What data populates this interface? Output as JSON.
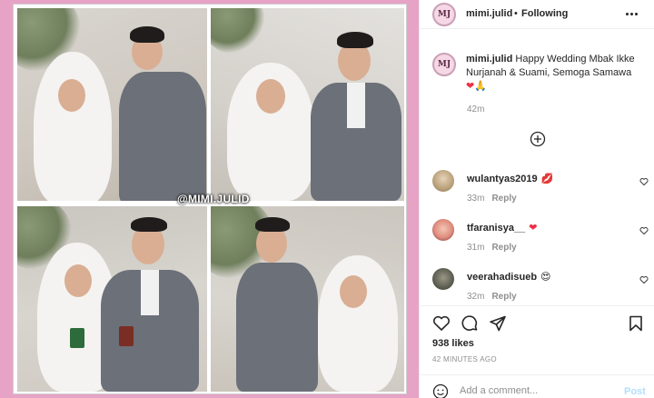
{
  "photo": {
    "watermark": "@MIMI.JULID",
    "background_color": "#e7a3c5"
  },
  "header": {
    "avatar_text": "MJ",
    "username": "mimi.julid",
    "separator": "•",
    "follow_status": "Following",
    "more_icon": "more-horizontal-icon"
  },
  "caption": {
    "avatar_text": "MJ",
    "username": "mimi.julid",
    "text": "Happy Wedding Mbak Ikke Nurjanah & Suami, Semoga Samawa",
    "emojis": [
      "❤",
      "🙏"
    ],
    "time": "42m"
  },
  "load_more_icon": "plus-circle-icon",
  "comments": [
    {
      "username": "wulantyas2019",
      "emoji": "💋",
      "time": "33m",
      "reply_label": "Reply",
      "avatar_color": "#b9a07a"
    },
    {
      "username": "tfaranisya__",
      "emoji": "❤",
      "time": "31m",
      "reply_label": "Reply",
      "avatar_color": "#e08d7f"
    },
    {
      "username": "veerahadisueb",
      "emoji": "😍",
      "time": "32m",
      "reply_label": "Reply",
      "avatar_color": "#5d5f52"
    }
  ],
  "actions": {
    "like_icon": "heart-icon",
    "comment_icon": "comment-icon",
    "share_icon": "send-icon",
    "save_icon": "bookmark-icon"
  },
  "likes": "938 likes",
  "post_time": "42 MINUTES AGO",
  "add_comment": {
    "emoji_icon": "smiley-icon",
    "placeholder": "Add a comment...",
    "post_label": "Post"
  },
  "colors": {
    "accent_link": "#b2dffc",
    "text_primary": "#262626",
    "text_secondary": "#8e8e8e",
    "heart_red": "#ed2f45"
  }
}
